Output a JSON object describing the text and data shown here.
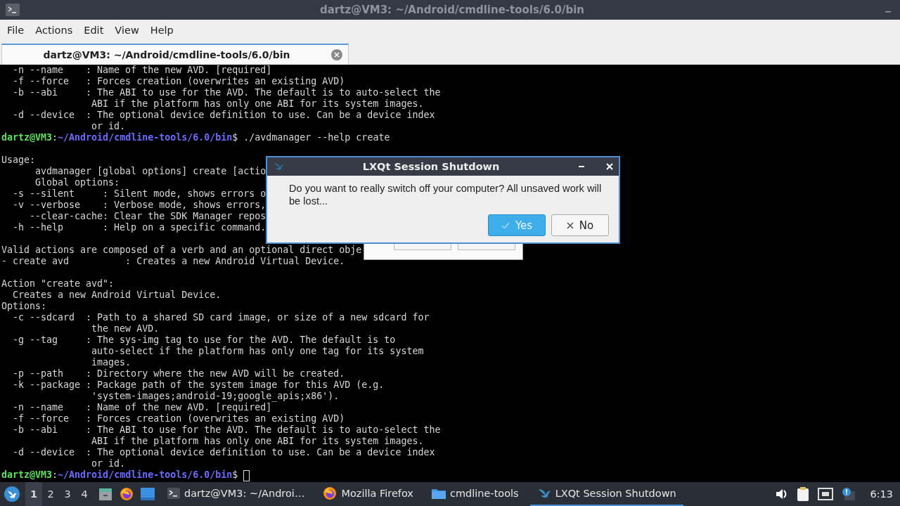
{
  "window": {
    "title": "dartz@VM3: ~/Android/cmdline-tools/6.0/bin"
  },
  "menu": [
    "File",
    "Actions",
    "Edit",
    "View",
    "Help"
  ],
  "tabs": [
    {
      "label": "dartz@VM3: ~/Android/cmdline-tools/6.0/bin",
      "selected": true
    }
  ],
  "terminal": {
    "lines": [
      {
        "kind": "text",
        "text": "  -n --name    : Name of the new AVD. [required]"
      },
      {
        "kind": "text",
        "text": "  -f --force   : Forces creation (overwrites an existing AVD)"
      },
      {
        "kind": "text",
        "text": "  -b --abi     : The ABI to use for the AVD. The default is to auto-select the"
      },
      {
        "kind": "text",
        "text": "                ABI if the platform has only one ABI for its system images."
      },
      {
        "kind": "text",
        "text": "  -d --device  : The optional device definition to use. Can be a device index"
      },
      {
        "kind": "text",
        "text": "                or id."
      },
      {
        "kind": "prompt",
        "user": "dartz@VM3",
        "sep": ":",
        "path": "~/Android/cmdline-tools/6.0/bin",
        "command": "$ ./avdmanager --help create",
        "cursor": false
      },
      {
        "kind": "blank"
      },
      {
        "kind": "text",
        "text": "Usage:"
      },
      {
        "kind": "text",
        "text": "      avdmanager [global options] create [actio"
      },
      {
        "kind": "text",
        "text": "      Global options:"
      },
      {
        "kind": "text",
        "text": "  -s --silent     : Silent mode, shows errors o"
      },
      {
        "kind": "text",
        "text": "  -v --verbose    : Verbose mode, shows errors,"
      },
      {
        "kind": "text",
        "text": "     --clear-cache: Clear the SDK Manager repos"
      },
      {
        "kind": "text",
        "text": "  -h --help       : Help on a specific command."
      },
      {
        "kind": "blank"
      },
      {
        "kind": "text",
        "text": "Valid actions are composed of a verb and an optional direct obje"
      },
      {
        "kind": "text",
        "text": "- create avd          : Creates a new Android Virtual Device."
      },
      {
        "kind": "blank"
      },
      {
        "kind": "text",
        "text": "Action \"create avd\":"
      },
      {
        "kind": "text",
        "text": "  Creates a new Android Virtual Device."
      },
      {
        "kind": "text",
        "text": "Options:"
      },
      {
        "kind": "text",
        "text": "  -c --sdcard  : Path to a shared SD card image, or size of a new sdcard for"
      },
      {
        "kind": "text",
        "text": "                the new AVD."
      },
      {
        "kind": "text",
        "text": "  -g --tag     : The sys-img tag to use for the AVD. The default is to"
      },
      {
        "kind": "text",
        "text": "                auto-select if the platform has only one tag for its system"
      },
      {
        "kind": "text",
        "text": "                images."
      },
      {
        "kind": "text",
        "text": "  -p --path    : Directory where the new AVD will be created."
      },
      {
        "kind": "text",
        "text": "  -k --package : Package path of the system image for this AVD (e.g."
      },
      {
        "kind": "text",
        "text": "                'system-images;android-19;google_apis;x86')."
      },
      {
        "kind": "text",
        "text": "  -n --name    : Name of the new AVD. [required]"
      },
      {
        "kind": "text",
        "text": "  -f --force   : Forces creation (overwrites an existing AVD)"
      },
      {
        "kind": "text",
        "text": "  -b --abi     : The ABI to use for the AVD. The default is to auto-select the"
      },
      {
        "kind": "text",
        "text": "                ABI if the platform has only one ABI for its system images."
      },
      {
        "kind": "text",
        "text": "  -d --device  : The optional device definition to use. Can be a device index"
      },
      {
        "kind": "text",
        "text": "                or id."
      },
      {
        "kind": "prompt",
        "user": "dartz@VM3",
        "sep": ":",
        "path": "~/Android/cmdline-tools/6.0/bin",
        "command": "$ ",
        "cursor": true
      }
    ]
  },
  "dialog": {
    "title": "LXQt Session Shutdown",
    "message": "Do you want to really switch off your computer? All unsaved work will be lost...",
    "buttons": [
      {
        "label": "Yes",
        "kind": "check",
        "default": true
      },
      {
        "label": "No",
        "kind": "cross",
        "default": false
      }
    ]
  },
  "taskbar": {
    "desktops": [
      {
        "label": "1",
        "selected": true
      },
      {
        "label": "2",
        "selected": false
      },
      {
        "label": "3",
        "selected": false
      },
      {
        "label": "4",
        "selected": false
      }
    ],
    "launchers": [
      {
        "kind": "cabinet"
      },
      {
        "kind": "firefox"
      },
      {
        "kind": "desktop"
      }
    ],
    "tasks": [
      {
        "label": "dartz@VM3: ~/Androi…",
        "kind": "terminal",
        "selected": false
      },
      {
        "label": "Mozilla Firefox",
        "kind": "firefox",
        "selected": false
      },
      {
        "label": "cmdline-tools",
        "kind": "folder",
        "selected": false
      },
      {
        "label": "LXQt Session Shutdown",
        "kind": "lxqt",
        "selected": true
      }
    ],
    "clock": "6:13"
  }
}
